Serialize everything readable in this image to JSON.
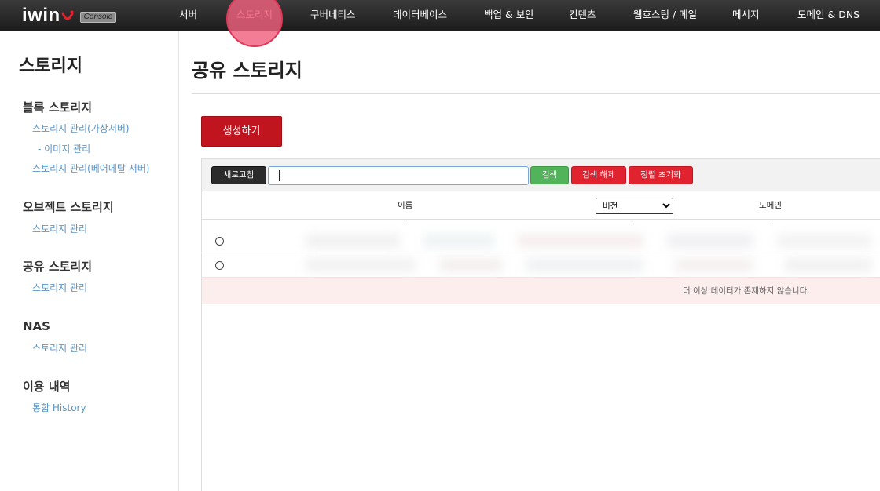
{
  "brand": {
    "logo_text": "iwin",
    "badge": "Console",
    "colors": {
      "nav_bg": "#2a2a2a",
      "accent": "#c0141f",
      "link": "#5b95c6",
      "green": "#53b35a",
      "red": "#e0232f"
    }
  },
  "nav": {
    "items": [
      {
        "label": "서버"
      },
      {
        "label": "스토리지"
      },
      {
        "label": "쿠버네티스"
      },
      {
        "label": "데이터베이스"
      },
      {
        "label": "백업 & 보안"
      },
      {
        "label": "컨텐츠"
      },
      {
        "label": "웹호스팅 / 메일"
      },
      {
        "label": "메시지"
      },
      {
        "label": "도메인 & DNS"
      }
    ],
    "active_index": 1
  },
  "sidebar": {
    "title": "스토리지",
    "sections": [
      {
        "heading": "블록 스토리지",
        "links": [
          "스토리지 관리(가상서버)",
          "- 이미지 관리",
          "스토리지 관리(베어메탈 서버)"
        ]
      },
      {
        "heading": "오브젝트 스토리지",
        "links": [
          "스토리지 관리"
        ]
      },
      {
        "heading": "공유 스토리지",
        "links": [
          "스토리지 관리"
        ]
      },
      {
        "heading": "NAS",
        "links": [
          "스토리지 관리"
        ]
      },
      {
        "heading": "이용 내역",
        "links": [
          "통합 History"
        ]
      }
    ]
  },
  "main": {
    "title": "공유 스토리지",
    "create_button": "생성하기",
    "toolbar": {
      "refresh": "새로고침",
      "search_value": "",
      "search": "검색",
      "clear_search": "검색 해제",
      "reset_sort": "정렬 초기화"
    },
    "table": {
      "columns": {
        "name": "이름",
        "version": "버전",
        "domain": "도메인"
      },
      "version_selected": "버전",
      "row_count": 2,
      "empty_message": "더 이상 데이터가 존재하지 않습니다."
    }
  }
}
